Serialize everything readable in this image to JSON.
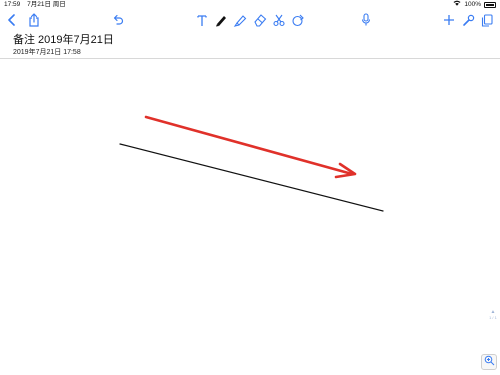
{
  "status_bar": {
    "time": "17:59",
    "date": "7月21日 周日",
    "battery": "100%"
  },
  "toolbar": {
    "left": [
      {
        "icon": "back-chevron-icon"
      },
      {
        "icon": "share-icon"
      },
      {
        "icon": "undo-icon"
      }
    ],
    "tools": [
      {
        "icon": "text-tool-icon"
      },
      {
        "icon": "pen-tool-icon"
      },
      {
        "icon": "highlighter-tool-icon"
      },
      {
        "icon": "eraser-tool-icon"
      },
      {
        "icon": "lasso-scissors-icon"
      },
      {
        "icon": "element-shape-icon"
      }
    ],
    "right": [
      {
        "icon": "microphone-icon"
      },
      {
        "icon": "add-icon"
      },
      {
        "icon": "wrench-icon"
      },
      {
        "icon": "page-copy-icon"
      }
    ],
    "accent_color": "#3a7cf2"
  },
  "note": {
    "title": "备注 2019年7月21日",
    "datetime": "2019年7月21日 17:58"
  },
  "canvas": {
    "strokes": [
      {
        "kind": "arrow",
        "color": "#e0312a"
      },
      {
        "kind": "line",
        "color": "#111111"
      }
    ]
  },
  "pager": {
    "text": "1 / 1"
  },
  "zoom_button": {
    "icon": "zoom-in-icon"
  }
}
